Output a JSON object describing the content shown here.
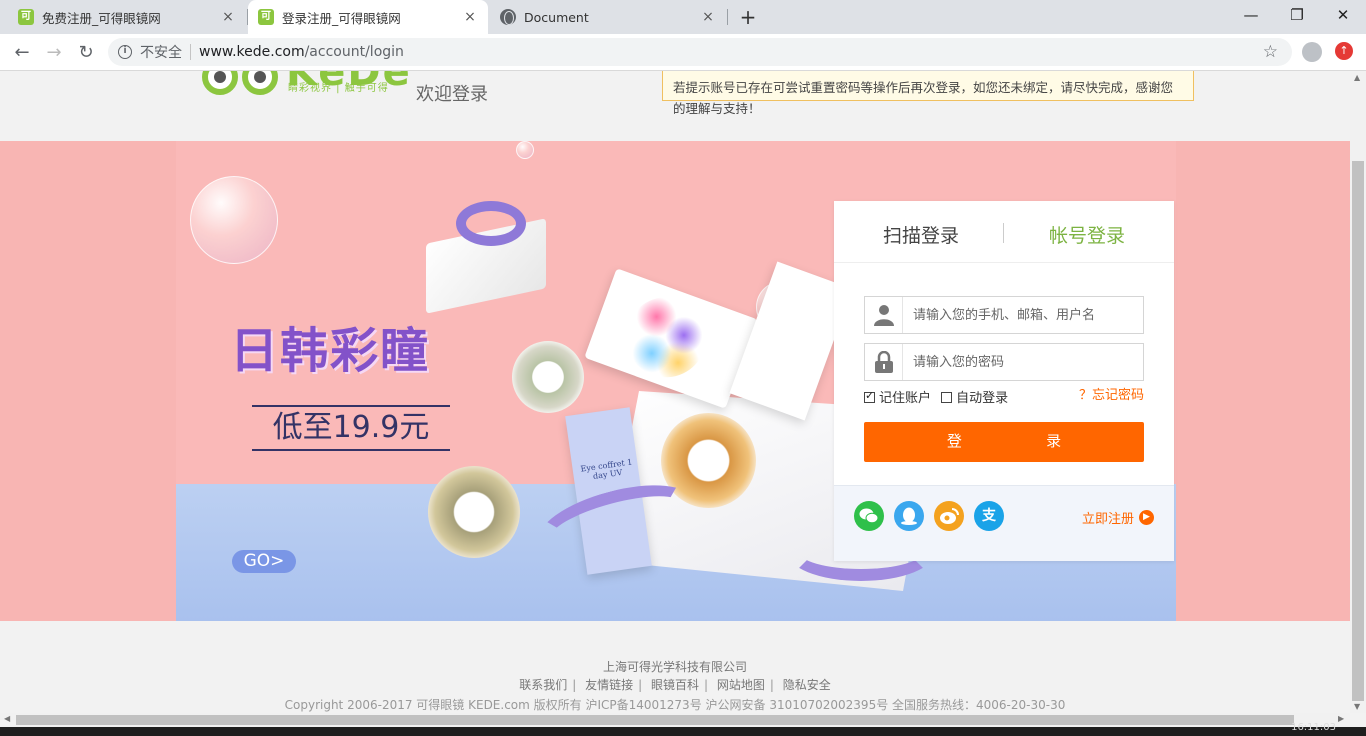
{
  "browser": {
    "tabs": [
      {
        "title": "免费注册_可得眼镜网",
        "favicon": "kede-icon"
      },
      {
        "title": "登录注册_可得眼镜网",
        "favicon": "kede-icon",
        "active": true
      },
      {
        "title": "Document",
        "favicon": "globe-icon"
      }
    ],
    "security_label": "不安全",
    "url_host": "www.kede.com",
    "url_path": "/account/login",
    "new_tab_glyph": "+",
    "close_glyph": "×"
  },
  "header": {
    "brand": "KeDe",
    "slogan": "睛彩视界 | 触手可得",
    "welcome": "欢迎登录",
    "notice": "若提示账号已存在可尝试重置密码等操作后再次登录，如您还未绑定，请尽快完成，感谢您的理解与支持！"
  },
  "banner": {
    "title": "日韩彩瞳",
    "price": "低至19.9元",
    "go": "GO>",
    "product_text": "Eye coffret 1 day UV"
  },
  "login": {
    "tab_scan": "扫描登录",
    "tab_account": "帐号登录",
    "username_placeholder": "请输入您的手机、邮箱、用户名",
    "password_placeholder": "请输入您的密码",
    "remember_label": "记住账户",
    "remember_checked": true,
    "auto_label": "自动登录",
    "auto_checked": false,
    "forgot": "？忘记密码",
    "submit": "登 录",
    "register": "立即注册",
    "social_icons": [
      "wechat-icon",
      "qq-icon",
      "weibo-icon",
      "alipay-icon"
    ]
  },
  "footer": {
    "company": "上海可得光学科技有限公司",
    "links": [
      "联系我们",
      "友情链接",
      "眼镜百科",
      "网站地图",
      "隐私安全"
    ],
    "copyright": "Copyright 2006-2017 可得眼镜 KEDE.com 版权所有 沪ICP备14001273号 沪公网安备 31010702002395号 全国服务热线：4006-20-30-30"
  },
  "taskbar": {
    "clock": "16:11:03"
  },
  "colors": {
    "accent": "#ff6600",
    "brand": "#8cc63f",
    "promo": "#8352c9"
  }
}
